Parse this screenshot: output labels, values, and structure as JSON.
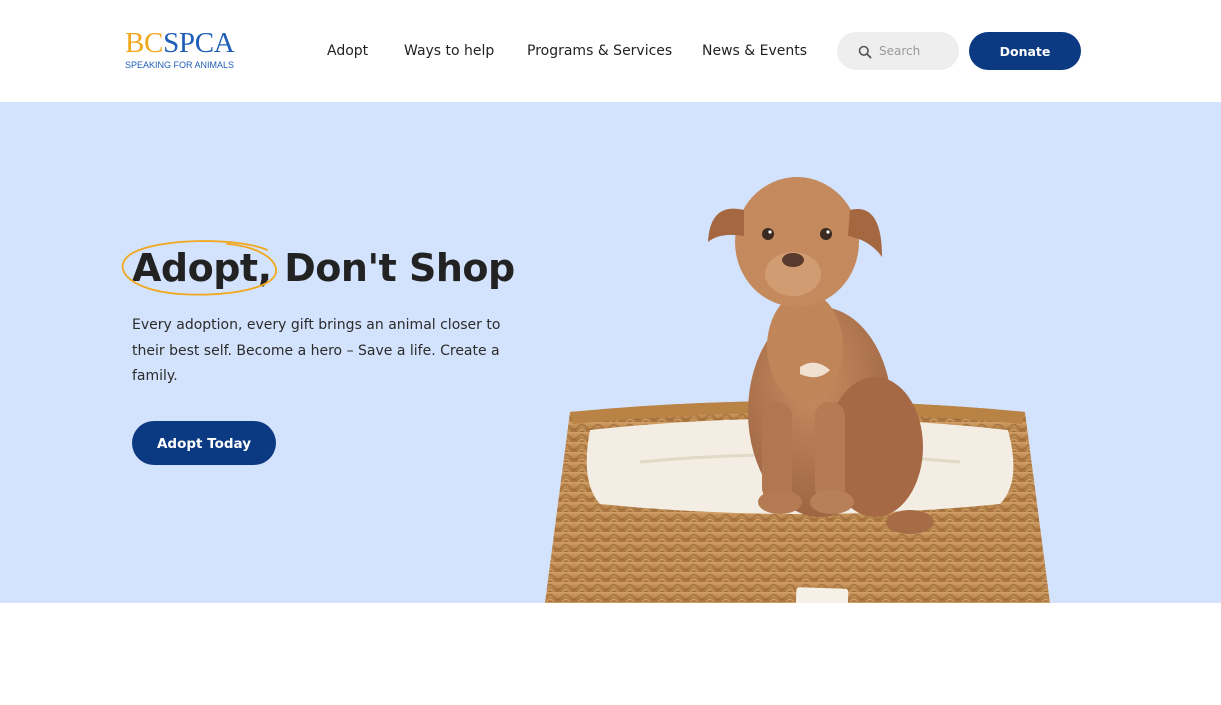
{
  "logo": {
    "bc": "BC",
    "spca": "SPCA",
    "tagline": "SPEAKING FOR ANIMALS"
  },
  "nav": {
    "items": [
      {
        "label": "Adopt"
      },
      {
        "label": "Ways to help"
      },
      {
        "label": "Programs & Services"
      },
      {
        "label": "News & Events"
      }
    ]
  },
  "search": {
    "placeholder": "Search",
    "icon": "search-icon"
  },
  "donate": {
    "label": "Donate"
  },
  "hero": {
    "title_circled": "Adopt,",
    "title_rest": " Don't Shop",
    "description": "Every adoption, every gift brings an animal closer to their best self. Become a hero – Save a life. Create a family.",
    "cta": "Adopt Today",
    "image": "puppy-on-woven-basket-bed"
  },
  "colors": {
    "hero_background": "#d4e3fd",
    "primary_button": "#0b3a82",
    "accent_orange": "#f0a81c",
    "logo_blue": "#1f5fb8"
  }
}
